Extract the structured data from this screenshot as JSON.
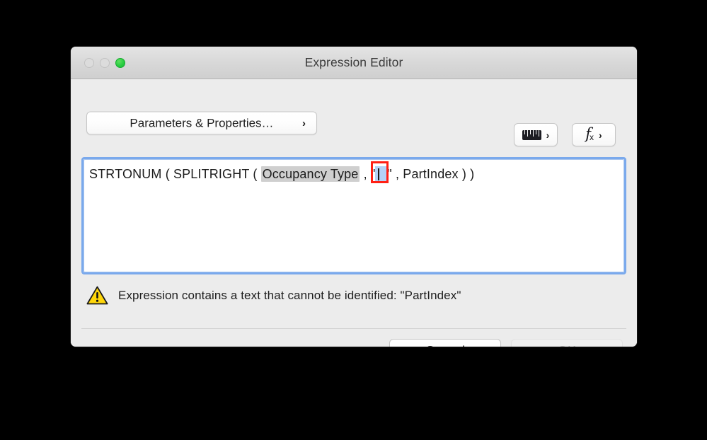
{
  "window": {
    "title": "Expression Editor",
    "controls": [
      {
        "name": "close",
        "state": "disabled"
      },
      {
        "name": "minimize",
        "state": "disabled"
      },
      {
        "name": "zoom",
        "state": "enabled",
        "color": "#28cd41"
      }
    ]
  },
  "toolbar": {
    "parameters_button": {
      "label": "Parameters & Properties…",
      "chevron": "›"
    },
    "ruler_button": {
      "icon": "ruler-icon",
      "chevron": "›"
    },
    "function_button": {
      "icon": "fx-icon",
      "label_f": "f",
      "label_x": "x",
      "chevron": "›"
    }
  },
  "expression": {
    "full_text": "STRTONUM ( SPLITRIGHT ( Occupancy Type , \"|\" , PartIndex ) )",
    "prefix": "STRTONUM ( SPLITRIGHT ( ",
    "field_token": "Occupancy Type",
    "mid": " , \"",
    "selected_value": "|",
    "post_quote": "\" , ",
    "unknown_token": "PartIndex",
    "suffix": " ) )",
    "focused": true,
    "focus_ring_color": "#7aa9ec",
    "token_background": "#cfcfcf",
    "selection_background": "#b4d2f7",
    "annotation_box_color": "#ff2015"
  },
  "warning": {
    "icon": "warning-triangle-icon",
    "message": "Expression contains a text that cannot be identified: \"PartIndex\"",
    "icon_fill": "#ffd60a"
  },
  "footer": {
    "cancel_label": "Cancel",
    "ok_label": "OK",
    "cancel_state": "enabled",
    "ok_state": "disabled"
  }
}
